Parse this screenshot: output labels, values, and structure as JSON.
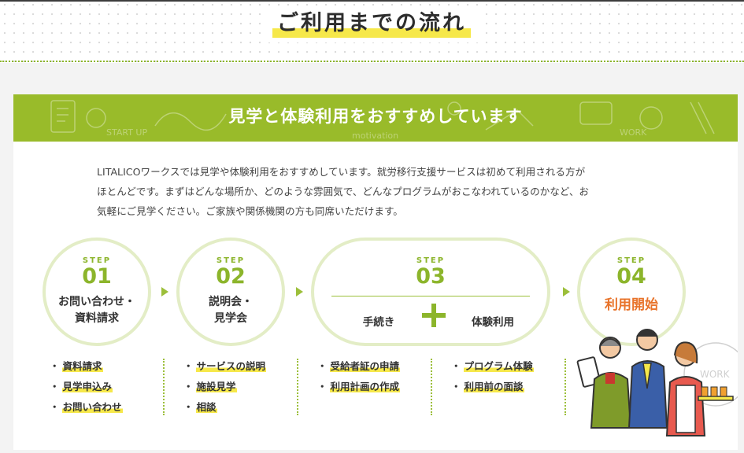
{
  "header": {
    "title": "ご利用までの流れ"
  },
  "banner": {
    "title": "見学と体験利用をおすすめしています"
  },
  "intro": {
    "lines": [
      "LITALICOワークスでは見学や体験利用をおすすめしています。就労移行支援サービスは初めて利用される方が",
      "ほとんどです。まずはどんな場所か、どのような雰囲気で、どんなプログラムがおこなわれているのかなど、お",
      "気軽にご見学ください。ご家族や関係機関の方も同席いただけます。"
    ]
  },
  "steps": [
    {
      "word": "STEP",
      "num": "01",
      "label_lines": [
        "お問い合わせ・",
        "資料請求"
      ]
    },
    {
      "word": "STEP",
      "num": "02",
      "label_lines": [
        "説明会・",
        "見学会"
      ]
    },
    {
      "word": "STEP",
      "num": "03",
      "left": "手続き",
      "right": "体験利用"
    },
    {
      "word": "STEP",
      "num": "04",
      "label": "利用開始"
    }
  ],
  "lists": [
    {
      "bullet": "・",
      "items": [
        "資料請求",
        "見学申込み",
        "お問い合わせ"
      ]
    },
    {
      "bullet": "・",
      "items": [
        "サービスの説明",
        "施設見学",
        "相談"
      ]
    },
    {
      "bullet": "・",
      "items": [
        "受給者証の申請",
        "利用計画の作成"
      ]
    },
    {
      "bullet": "・",
      "items": [
        "プログラム体験",
        "利用前の面談"
      ]
    }
  ],
  "banner_doodles": [
    "START UP",
    "motivation",
    "WORK"
  ],
  "illustration": {
    "stamp": "WORK"
  },
  "colors": {
    "accent_green": "#99bb2a",
    "highlight_yellow": "#f6e84a",
    "accent_orange": "#e8732a"
  }
}
